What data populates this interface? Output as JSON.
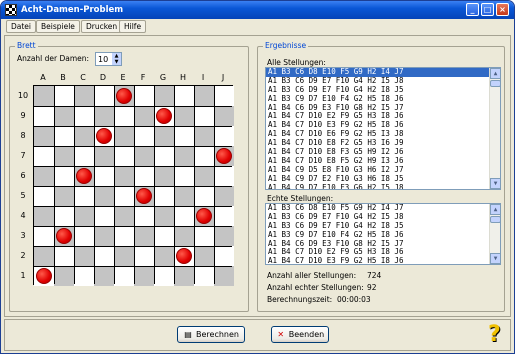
{
  "window": {
    "title": "Acht-Damen-Problem",
    "controls": [
      "_",
      "□",
      "×"
    ]
  },
  "menu": [
    "Datei",
    "Beispiele",
    "Drucken",
    "Hilfe"
  ],
  "brett": {
    "group_label": "Brett",
    "anzahl_label": "Anzahl der Damen:",
    "anzahl_value": "10",
    "columns": [
      "A",
      "B",
      "C",
      "D",
      "E",
      "F",
      "G",
      "H",
      "I",
      "J"
    ],
    "rows": [
      "10",
      "9",
      "8",
      "7",
      "6",
      "5",
      "4",
      "3",
      "2",
      "1"
    ],
    "queens": [
      {
        "col": "E",
        "row": "10"
      },
      {
        "col": "G",
        "row": "9"
      },
      {
        "col": "D",
        "row": "8"
      },
      {
        "col": "J",
        "row": "7"
      },
      {
        "col": "C",
        "row": "6"
      },
      {
        "col": "F",
        "row": "5"
      },
      {
        "col": "I",
        "row": "4"
      },
      {
        "col": "B",
        "row": "3"
      },
      {
        "col": "H",
        "row": "2"
      },
      {
        "col": "A",
        "row": "1"
      }
    ]
  },
  "ergebnisse": {
    "group_label": "Ergebnisse",
    "alle_label": "Alle Stellungen:",
    "alle_items": [
      "A1 B3 C6 D8 E10 F5 G9 H2 I4 J7",
      "A1 B3 C6 D9 E7 F10 G4 H2 I5 J8",
      "A1 B3 C6 D9 E7 F10 G4 H2 I8 J5",
      "A1 B3 C9 D7 E10 F4 G2 H5 I8 J6",
      "A1 B4 C6 D9 E3 F10 G8 H2 I5 J7",
      "A1 B4 C7 D10 E2 F9 G5 H3 I8 J6",
      "A1 B4 C7 D10 E3 F9 G2 H5 I8 J6",
      "A1 B4 C7 D10 E6 F9 G2 H5 I3 J8",
      "A1 B4 C7 D10 E8 F2 G5 H3 I6 J9",
      "A1 B4 C7 D10 E8 F3 G5 H9 I2 J6",
      "A1 B4 C7 D10 E8 F5 G2 H9 I3 J6",
      "A1 B4 C9 D5 E8 F10 G3 H6 I2 J7",
      "A1 B4 C9 D7 E2 F10 G3 H6 I8 J5",
      "A1 B4 C9 D7 E10 F3 G6 H2 I5 J8"
    ],
    "alle_selected": 0,
    "echte_label": "Echte Stellungen:",
    "echte_items": [
      "A1 B3 C6 D8 E10 F5 G9 H2 I4 J7",
      "A1 B3 C6 D9 E7 F10 G4 H2 I5 J8",
      "A1 B3 C6 D9 E7 F10 G4 H2 I8 J5",
      "A1 B3 C9 D7 E10 F4 G2 H5 I8 J6",
      "A1 B4 C6 D9 E3 F10 G8 H2 I5 J7",
      "A1 B4 C7 D10 E2 F9 G5 H3 I8 J6",
      "A1 B4 C7 D10 E3 F9 G2 H5 I8 J6"
    ],
    "stats": [
      {
        "label": "Anzahl aller Stellungen:",
        "value": "724"
      },
      {
        "label": "Anzahl echter Stellungen:",
        "value": "92"
      },
      {
        "label": "Berechnungszeit:",
        "value": "00:00:03"
      }
    ]
  },
  "buttons": {
    "berechnen": "Berechnen",
    "beenden": "Beenden"
  },
  "icons": {
    "berechnen": "calculator-icon",
    "beenden": "close-x-icon",
    "help": "help-question-icon"
  },
  "colors": {
    "queen": "#e00000",
    "dark_square": "#c4c4c4",
    "group_label": "#0046d5",
    "selection": "#316ac5"
  }
}
